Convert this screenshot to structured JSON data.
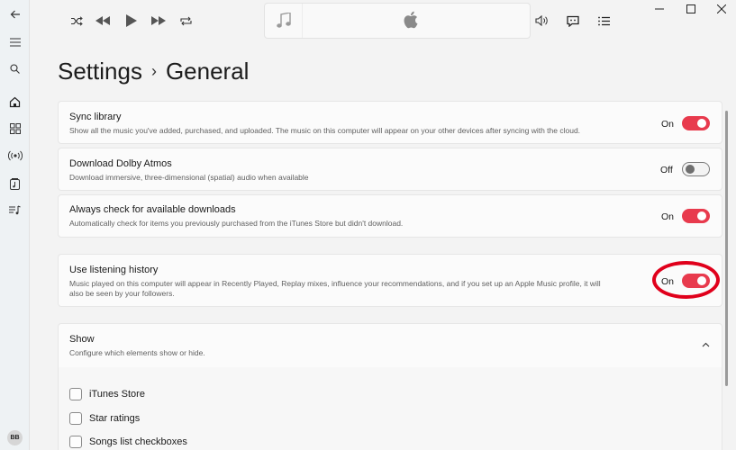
{
  "sidebar": {
    "items": [
      {
        "icon": "back-arrow-icon"
      },
      {
        "icon": "hamburger-menu-icon"
      },
      {
        "icon": "search-icon"
      },
      {
        "icon": "home-icon"
      },
      {
        "icon": "browse-grid-icon"
      },
      {
        "icon": "radio-icon"
      },
      {
        "icon": "library-icon"
      },
      {
        "icon": "playlist-icon"
      }
    ],
    "avatar": "BB"
  },
  "player": {
    "controls": [
      "shuffle-icon",
      "previous-icon",
      "play-icon",
      "next-icon",
      "repeat-icon"
    ],
    "right": [
      "volume-icon",
      "lyrics-icon",
      "queue-icon"
    ],
    "now_playing_logo": "apple-logo-icon"
  },
  "window": {
    "buttons": [
      "minimize-icon",
      "maximize-icon",
      "close-icon"
    ]
  },
  "page": {
    "title": "Settings",
    "separator": "›",
    "subtitle": "General"
  },
  "settings": [
    {
      "title": "Sync library",
      "desc": "Show all the music you've added, purchased, and uploaded. The music on this computer will appear on your other devices after syncing with the cloud.",
      "state": "On"
    },
    {
      "title": "Download Dolby Atmos",
      "desc": "Download immersive, three-dimensional (spatial) audio when available",
      "state": "Off"
    },
    {
      "title": "Always check for available downloads",
      "desc": "Automatically check for items you previously purchased from the iTunes Store but didn't download.",
      "state": "On"
    },
    {
      "title": "Use listening history",
      "desc1": "Music played on this computer will appear in Recently Played, Replay mixes, influence your recommendations, and if you set up an Apple Music profile, it will",
      "desc2": "also be seen by your followers.",
      "state": "On"
    }
  ],
  "show": {
    "title": "Show",
    "desc": "Configure which elements show or hide.",
    "items": [
      "iTunes Store",
      "Star ratings",
      "Songs list checkboxes"
    ]
  },
  "colors": {
    "accent": "#e83a4d",
    "highlight": "#e0001b"
  }
}
